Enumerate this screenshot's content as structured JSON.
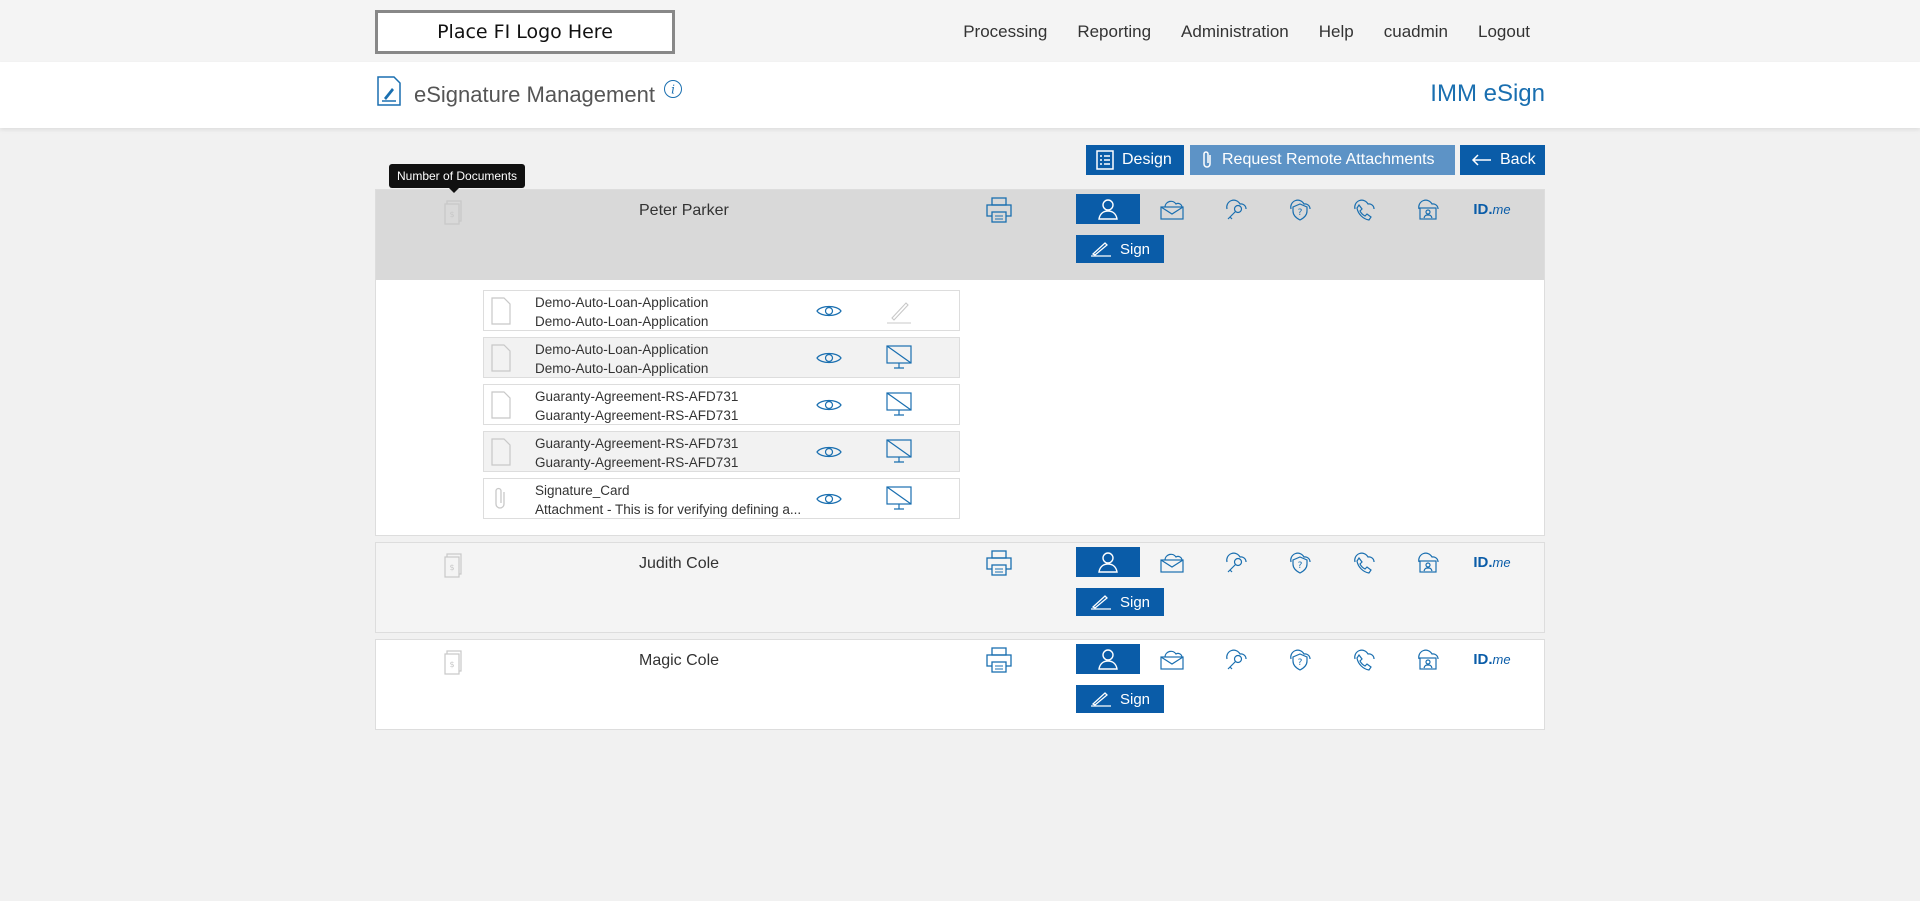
{
  "header": {
    "logo_text": "Place FI Logo Here",
    "nav": [
      "Processing",
      "Reporting",
      "Administration",
      "Help",
      "cuadmin",
      "Logout"
    ]
  },
  "titlebar": {
    "title": "eSignature Management",
    "brand": "IMM eSign"
  },
  "toolbar": {
    "design_label": "Design",
    "attachments_label": "Request Remote Attachments",
    "back_label": "Back"
  },
  "tooltip": "Number of Documents",
  "signers": [
    {
      "name": "Peter Parker",
      "sign_label": "Sign",
      "documents": [
        {
          "line1": "Demo-Auto-Loan-Application",
          "line2": "Demo-Auto-Loan-Application",
          "type": "document",
          "status": "sign"
        },
        {
          "line1": "Demo-Auto-Loan-Application",
          "line2": "Demo-Auto-Loan-Application",
          "type": "document",
          "status": "no-display"
        },
        {
          "line1": "Guaranty-Agreement-RS-AFD731",
          "line2": "Guaranty-Agreement-RS-AFD731",
          "type": "document",
          "status": "no-display"
        },
        {
          "line1": "Guaranty-Agreement-RS-AFD731",
          "line2": "Guaranty-Agreement-RS-AFD731",
          "type": "document",
          "status": "no-display"
        },
        {
          "line1": "Signature_Card",
          "line2": "Attachment - This is for verifying defining a...",
          "type": "attachment",
          "status": "no-display"
        }
      ]
    },
    {
      "name": "Judith Cole",
      "sign_label": "Sign"
    },
    {
      "name": "Magic Cole",
      "sign_label": "Sign"
    }
  ],
  "auth_methods": [
    "in-person-icon",
    "email-icon",
    "key-icon",
    "question-shield-icon",
    "phone-icon",
    "cloud-id-icon",
    "idme-logo"
  ],
  "idme": {
    "id": "ID.",
    "me": "me"
  },
  "colors": {
    "accent": "#0a5ca8",
    "accent_light": "#5d93c6",
    "brand_text": "#1a6fb0"
  }
}
